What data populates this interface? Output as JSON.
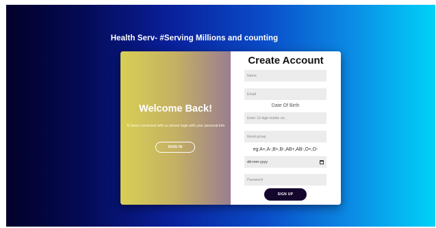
{
  "headline": "Health Serv- #Serving Millions and counting",
  "overlay": {
    "title": "Welcome Back!",
    "text": "To keep connected with us please login with your personal info",
    "signin_label": "SIGN IN"
  },
  "form": {
    "title": "Create Account",
    "name_placeholder": "Name",
    "email_placeholder": "Email",
    "dob_label": "Date Of Birth",
    "mobile_placeholder": "Enter 10 digit mobile no.",
    "blood_placeholder": "blood group",
    "blood_hint": "eg:A+,A-,B+,B-,AB+,AB-,O+,O-",
    "date_value": "dd-mm-yyyy",
    "password_placeholder": "Password",
    "signup_label": "SIGN UP"
  },
  "icons": {
    "date_picker": "calendar-icon"
  },
  "colors": {
    "background_left": "#03002a",
    "background_right": "#00d2f8",
    "overlay_left": "#d8cf55",
    "overlay_right": "#9a7e90",
    "button_dark": "#14062d",
    "input_bg": "#ececec"
  }
}
